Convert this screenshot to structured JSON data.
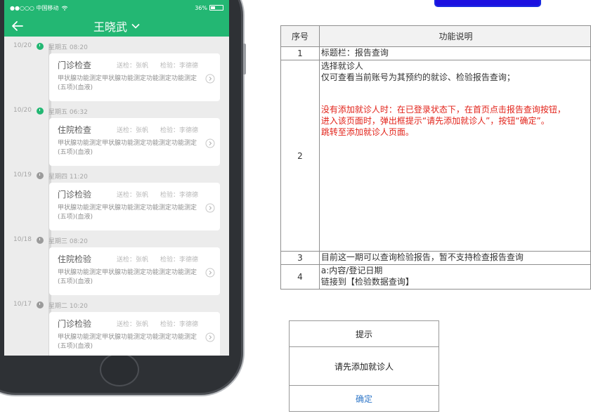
{
  "status_bar": {
    "carrier": "●●○○○ 中国移动",
    "battery_text": "36%",
    "battery_level": 0.36
  },
  "nav": {
    "title": "王晓武"
  },
  "records": [
    {
      "date": "10/20",
      "weekday_time": "星期五  08:20",
      "dot": "green",
      "title": "门诊检查",
      "sender": "送检：张帆",
      "checker": "检验：李德德",
      "desc": "甲状腺功能测定甲状腺功能测定功能测定功能测定(五项)(血液)"
    },
    {
      "date": "10/20",
      "weekday_time": "星期五  06:32",
      "dot": "green",
      "title": "住院检查",
      "sender": "送检：张帆",
      "checker": "检验：李德德",
      "desc": "甲状腺功能测定甲状腺功能测定功能测定功能测定(五项)(血液)"
    },
    {
      "date": "10/19",
      "weekday_time": "星期四  11:20",
      "dot": "gray",
      "title": "门诊检验",
      "sender": "送检：张帆",
      "checker": "检验：李德德",
      "desc": "甲状腺功能测定甲状腺功能测定功能测定功能测定(五项)(血液)"
    },
    {
      "date": "10/18",
      "weekday_time": "星期三  08:20",
      "dot": "gray",
      "title": "住院检验",
      "sender": "送检：张帆",
      "checker": "检验：李德德",
      "desc": "甲状腺功能测定甲状腺功能测定功能测定功能测定(五项)(血液)"
    },
    {
      "date": "10/17",
      "weekday_time": "星期二  10:20",
      "dot": "gray",
      "title": "门诊检验",
      "sender": "送检：张帆",
      "checker": "检验：李德德",
      "desc": "甲状腺功能测定甲状腺功能测定功能测定功能测定(五项)(血液)"
    }
  ],
  "spec_table": {
    "headers": [
      "序号",
      "功能说明"
    ],
    "rows": [
      {
        "num": "1",
        "lines": [
          "标题栏：报告查询"
        ],
        "red_lines": []
      },
      {
        "num": "2",
        "lines": [
          "选择就诊人",
          "仅可查看当前账号为其预约的就诊、检验报告查询；"
        ],
        "red_lines": [
          "没有添加就诊人时：在已登录状态下，在首页点击报告查询按钮，",
          "进入该页面时，弹出框提示“请先添加就诊人”，按钮“确定”。",
          "跳转至添加就诊人页面。"
        ]
      },
      {
        "num": "3",
        "lines": [
          "目前这一期可以查询检验报告，暂不支持检查报告查询"
        ],
        "red_lines": []
      },
      {
        "num": "4",
        "lines": [
          "a:内容/登记日期",
          "链接到【检验数据查询】"
        ],
        "red_lines": []
      }
    ]
  },
  "dialog": {
    "title": "提示",
    "message": "请先添加就诊人",
    "confirm": "确定"
  },
  "colors": {
    "brand_green": "#23b773",
    "highlight_red": "#e2231a",
    "link_blue": "#2f77c8",
    "top_button_blue": "#1c10e0"
  }
}
